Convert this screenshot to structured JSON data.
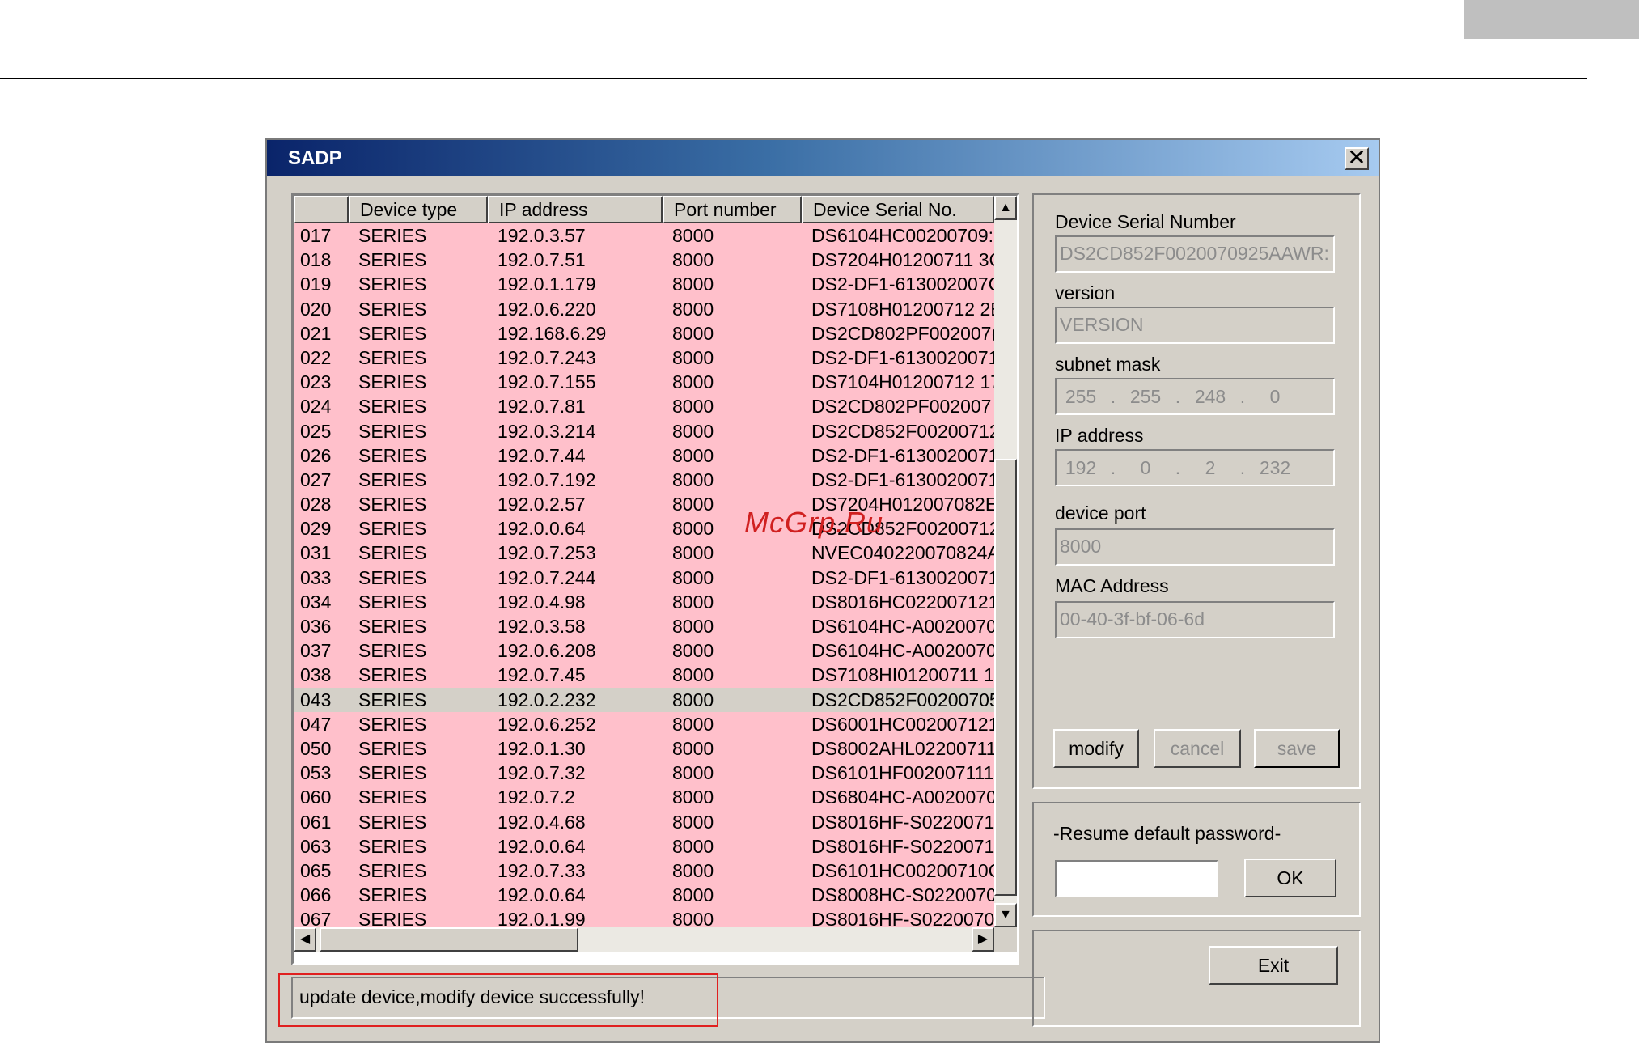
{
  "window": {
    "title": "SADP",
    "close_glyph": "✕"
  },
  "list": {
    "columns": [
      "",
      "Device type",
      "IP address",
      "Port number",
      "Device Serial No."
    ],
    "rows": [
      {
        "num": "017",
        "type": "SERIES",
        "ip": "192.0.3.57",
        "port": "8000",
        "serial": "DS6104HC00200709:"
      },
      {
        "num": "018",
        "type": "SERIES",
        "ip": "192.0.7.51",
        "port": "8000",
        "serial": "DS7204H01200711 3C"
      },
      {
        "num": "019",
        "type": "SERIES",
        "ip": "192.0.1.179",
        "port": "8000",
        "serial": "DS2-DF1-613002007C"
      },
      {
        "num": "020",
        "type": "SERIES",
        "ip": "192.0.6.220",
        "port": "8000",
        "serial": "DS7108H01200712 2E"
      },
      {
        "num": "021",
        "type": "SERIES",
        "ip": "192.168.6.29",
        "port": "8000",
        "serial": "DS2CD802PF002007("
      },
      {
        "num": "022",
        "type": "SERIES",
        "ip": "192.0.7.243",
        "port": "8000",
        "serial": "DS2-DF1-6130020071"
      },
      {
        "num": "023",
        "type": "SERIES",
        "ip": "192.0.7.155",
        "port": "8000",
        "serial": "DS7104H01200712 17"
      },
      {
        "num": "024",
        "type": "SERIES",
        "ip": "192.0.7.81",
        "port": "8000",
        "serial": "DS2CD802PF002007"
      },
      {
        "num": "025",
        "type": "SERIES",
        "ip": "192.0.3.214",
        "port": "8000",
        "serial": "DS2CD852F00200712"
      },
      {
        "num": "026",
        "type": "SERIES",
        "ip": "192.0.7.44",
        "port": "8000",
        "serial": "DS2-DF1-6130020071"
      },
      {
        "num": "027",
        "type": "SERIES",
        "ip": "192.0.7.192",
        "port": "8000",
        "serial": "DS2-DF1-6130020071"
      },
      {
        "num": "028",
        "type": "SERIES",
        "ip": "192.0.2.57",
        "port": "8000",
        "serial": "DS7204H012007082E"
      },
      {
        "num": "029",
        "type": "SERIES",
        "ip": "192.0.0.64",
        "port": "8000",
        "serial": "DS2CD852F00200712"
      },
      {
        "num": "031",
        "type": "SERIES",
        "ip": "192.0.7.253",
        "port": "8000",
        "serial": "NVEC040220070824A"
      },
      {
        "num": "033",
        "type": "SERIES",
        "ip": "192.0.7.244",
        "port": "8000",
        "serial": "DS2-DF1-6130020071"
      },
      {
        "num": "034",
        "type": "SERIES",
        "ip": "192.0.4.98",
        "port": "8000",
        "serial": "DS8016HC022007121"
      },
      {
        "num": "036",
        "type": "SERIES",
        "ip": "192.0.3.58",
        "port": "8000",
        "serial": "DS6104HC-A0020070"
      },
      {
        "num": "037",
        "type": "SERIES",
        "ip": "192.0.6.208",
        "port": "8000",
        "serial": "DS6104HC-A0020070"
      },
      {
        "num": "038",
        "type": "SERIES",
        "ip": "192.0.7.45",
        "port": "8000",
        "serial": "DS7108HI01200711 1:"
      },
      {
        "num": "043",
        "type": "SERIES",
        "ip": "192.0.2.232",
        "port": "8000",
        "serial": "DS2CD852F00200705"
      },
      {
        "num": "047",
        "type": "SERIES",
        "ip": "192.0.6.252",
        "port": "8000",
        "serial": "DS6001HC002007121"
      },
      {
        "num": "050",
        "type": "SERIES",
        "ip": "192.0.1.30",
        "port": "8000",
        "serial": "DS8002AHL02200711"
      },
      {
        "num": "053",
        "type": "SERIES",
        "ip": "192.0.7.32",
        "port": "8000",
        "serial": "DS6101HF002007111"
      },
      {
        "num": "060",
        "type": "SERIES",
        "ip": "192.0.7.2",
        "port": "8000",
        "serial": "DS6804HC-A0020070"
      },
      {
        "num": "061",
        "type": "SERIES",
        "ip": "192.0.4.68",
        "port": "8000",
        "serial": "DS8016HF-S0220071"
      },
      {
        "num": "063",
        "type": "SERIES",
        "ip": "192.0.0.64",
        "port": "8000",
        "serial": "DS8016HF-S0220071"
      },
      {
        "num": "065",
        "type": "SERIES",
        "ip": "192.0.7.33",
        "port": "8000",
        "serial": "DS6101HC00200710C"
      },
      {
        "num": "066",
        "type": "SERIES",
        "ip": "192.0.0.64",
        "port": "8000",
        "serial": "DS8008HC-S0220070"
      },
      {
        "num": "067",
        "type": "SERIES",
        "ip": "192.0.1.99",
        "port": "8000",
        "serial": "DS8016HF-S0220070"
      }
    ],
    "selected_row": "043"
  },
  "status": {
    "text": "update device,modify device successfully!"
  },
  "watermark": "McGrp.Ru",
  "details": {
    "serial_label": "Device Serial Number",
    "serial_value": "DS2CD852F0020070925AAWR:",
    "version_label": "version",
    "version_value": "VERSION",
    "subnet_label": "subnet mask",
    "subnet": [
      "255",
      "255",
      "248",
      "0"
    ],
    "ip_label": "IP address",
    "ip": [
      "192",
      "0",
      "2",
      "232"
    ],
    "port_label": "device port",
    "port_value": "8000",
    "mac_label": "MAC Address",
    "mac_value": "00-40-3f-bf-06-6d",
    "modify_label": "modify",
    "cancel_label": "cancel",
    "save_label": "save"
  },
  "password": {
    "label": "-Resume default password-",
    "ok_label": "OK"
  },
  "exit_label": "Exit",
  "colors": {
    "row_bg": "#ffc0cb",
    "selected_row_bg": "#d4d0c8",
    "dialog_bg": "#d4d0c8",
    "highlight_box": "#e02020",
    "watermark": "#d02020"
  }
}
